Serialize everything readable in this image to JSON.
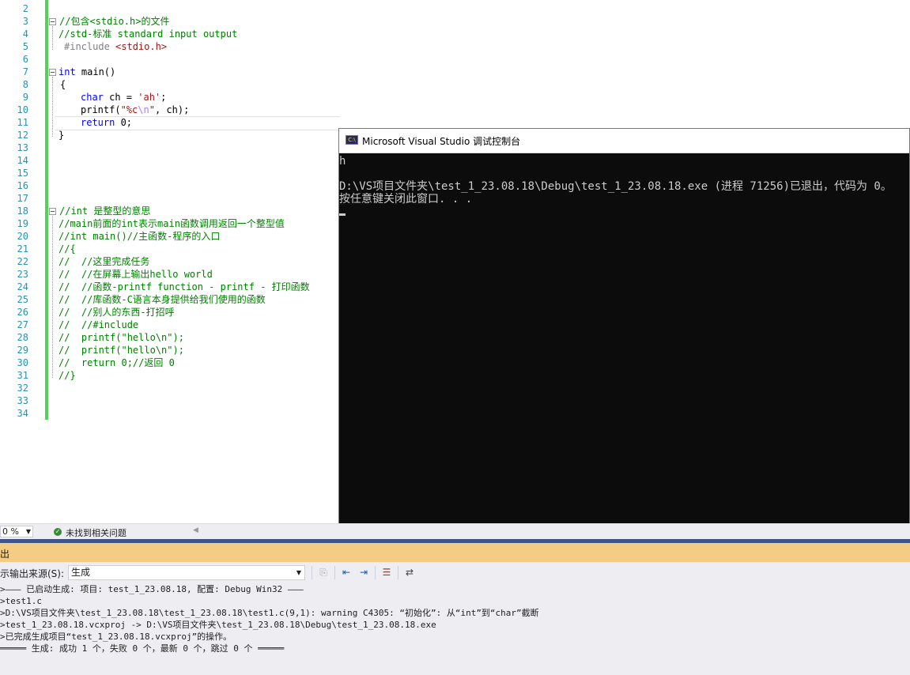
{
  "editor": {
    "line_numbers": [
      "2",
      "3",
      "4",
      "5",
      "6",
      "7",
      "8",
      "9",
      "10",
      "11",
      "12",
      "13",
      "14",
      "15",
      "16",
      "17",
      "18",
      "19",
      "20",
      "21",
      "22",
      "23",
      "24",
      "25",
      "26",
      "27",
      "28",
      "29",
      "30",
      "31",
      "32",
      "33",
      "34"
    ],
    "lines": {
      "l3": "//包含<stdio.h>的文件",
      "l4": "//std-标准 standard input output",
      "l5_a": "#include ",
      "l5_b": "<stdio.h>",
      "l7_kw": "int",
      "l7_rest": " main()",
      "l8": "{",
      "l9_kw": "char",
      "l9_mid": " ch = ",
      "l9_str": "'ah'",
      "l9_end": ";",
      "l10_fn": "printf(",
      "l10_s1": "\"%c",
      "l10_esc": "\\n",
      "l10_s2": "\"",
      "l10_end": ", ch);",
      "l11_kw": "return",
      "l11_end": " 0;",
      "l12": "}",
      "l18": "//int 是整型的意思",
      "l19": "//main前面的int表示main函数调用返回一个整型值",
      "l20": "//int main()//主函数-程序的入口",
      "l21": "//{",
      "l22": "//  //这里完成任务",
      "l23": "//  //在屏幕上输出hello world",
      "l24": "//  //函数-printf function - printf - 打印函数",
      "l25": "//  //库函数-C语言本身提供给我们使用的函数",
      "l26": "//  //别人的东西-打招呼",
      "l27": "//  //#include",
      "l28": "//  printf(\"hello\\n\");",
      "l29": "//  printf(\"hello\\n\");",
      "l30": "//  return 0;//返回 0",
      "l31": "//}"
    }
  },
  "console": {
    "icon_text": "C:\\",
    "title": "Microsoft Visual Studio 调试控制台",
    "lines": [
      "h",
      "",
      "D:\\VS项目文件夹\\test_1_23.08.18\\Debug\\test_1_23.08.18.exe (进程 71256)已退出，代码为 0。",
      "按任意键关闭此窗口. . ."
    ]
  },
  "statusbar": {
    "zoom": "0 %",
    "issues": "未找到相关问题"
  },
  "output": {
    "panel_title": "出",
    "source_label": "示输出来源(S):",
    "source_value": "生成",
    "lines": [
      ">——— 已启动生成: 项目: test_1_23.08.18, 配置: Debug Win32 ———",
      ">test1.c",
      ">D:\\VS项目文件夹\\test_1_23.08.18\\test_1_23.08.18\\test1.c(9,1): warning C4305: “初始化”: 从“int”到“char”截断",
      ">test_1_23.08.18.vcxproj -> D:\\VS项目文件夹\\test_1_23.08.18\\Debug\\test_1_23.08.18.exe",
      ">已完成生成项目“test_1_23.08.18.vcxproj”的操作。",
      "═════ 生成: 成功 1 个，失败 0 个，最新 0 个，跳过 0 个 ═════"
    ]
  },
  "colors": {
    "comment": "#008000",
    "keyword": "#0000ff",
    "string": "#a31515",
    "output_header": "#f5cc84",
    "change_bar": "#57d05a"
  }
}
